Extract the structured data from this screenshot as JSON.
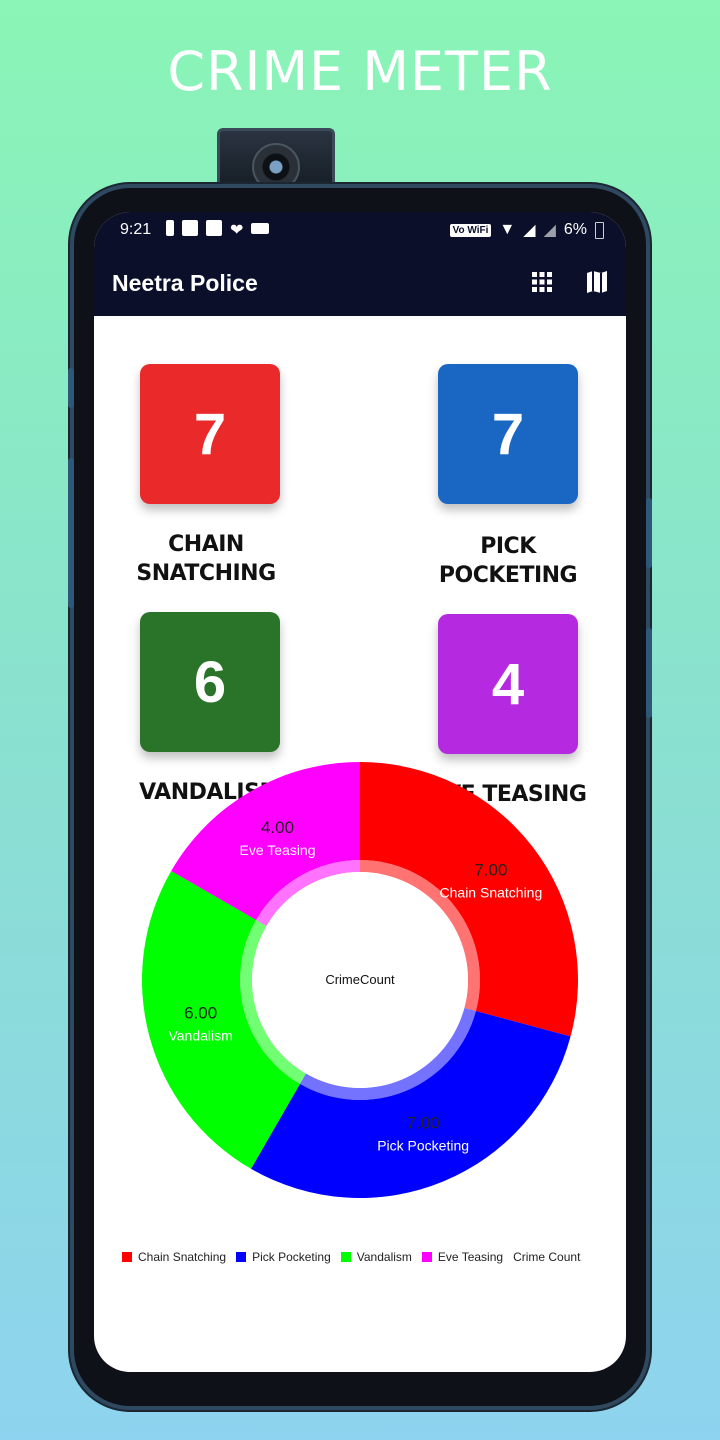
{
  "promo": {
    "title": "CRIME METER"
  },
  "status": {
    "time": "9:21",
    "wifi_badge": "Vo WiFi",
    "battery": "6%"
  },
  "appbar": {
    "title": "Neetra Police",
    "icons": [
      "grid-icon",
      "map-icon"
    ]
  },
  "tiles": [
    {
      "count": "7",
      "label": "CHAIN SNATCHING",
      "color": "#ea2a2a"
    },
    {
      "count": "7",
      "label": "PICK POCKETING",
      "color": "#1967c2"
    },
    {
      "count": "6",
      "label": "VANDALISM",
      "color": "#2a742a"
    },
    {
      "count": "4",
      "label": "EVE TEASING",
      "color": "#b52ae0"
    }
  ],
  "chart_data": {
    "type": "pie",
    "center_text": "CrimeCount",
    "categories": [
      "Chain Snatching",
      "Pick Pocketing",
      "Vandalism",
      "Eve Teasing"
    ],
    "values": [
      7,
      7,
      6,
      4
    ],
    "value_labels": [
      "7.00",
      "7.00",
      "6.00",
      "4.00"
    ],
    "colors": [
      "#ff0000",
      "#0000ff",
      "#00ff00",
      "#ff00ff"
    ],
    "legend_position": "bottom-left",
    "legend_label": "Crime Count"
  }
}
